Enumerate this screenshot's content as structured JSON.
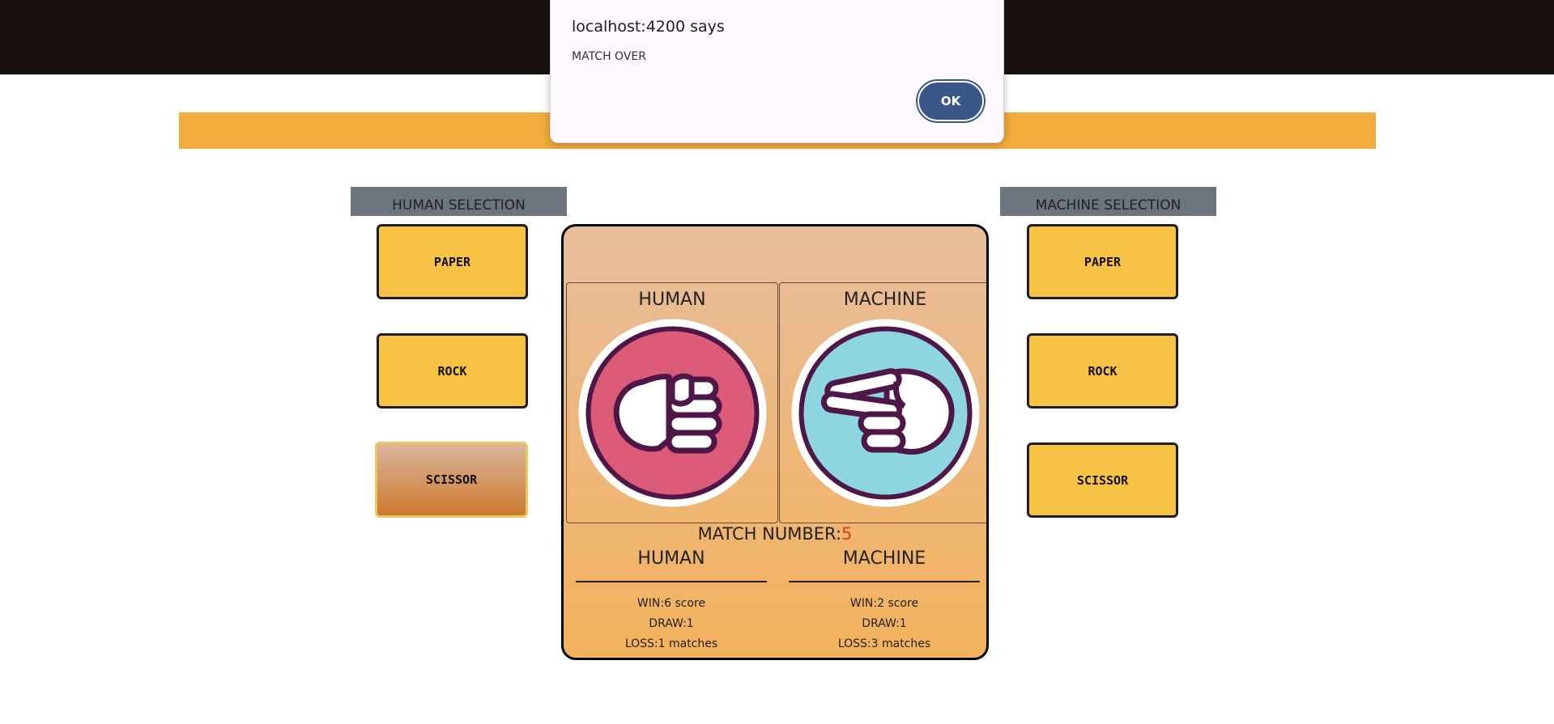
{
  "human_selection": {
    "header": "HUMAN SELECTION",
    "options": [
      "PAPER",
      "ROCK",
      "SCISSOR"
    ],
    "selected": "SCISSOR"
  },
  "machine_selection": {
    "header": "MACHINE SELECTION",
    "options": [
      "PAPER",
      "ROCK",
      "SCISSOR"
    ]
  },
  "arena": {
    "human_label": "HUMAN",
    "machine_label": "MACHINE",
    "human_hand_icon": "rock-fist-icon",
    "machine_hand_icon": "scissor-hand-icon",
    "match_number_label": "MATCH NUMBER:",
    "match_number": "5"
  },
  "scores": {
    "human": {
      "title": "HUMAN",
      "win": "WIN:6 score",
      "draw": "DRAW:1",
      "loss": "LOSS:1 matches"
    },
    "machine": {
      "title": "MACHINE",
      "win": "WIN:2 score",
      "draw": "DRAW:1",
      "loss": "LOSS:3 matches"
    }
  },
  "dialog": {
    "title": "localhost:4200 says",
    "message": "MATCH OVER",
    "ok_label": "OK"
  },
  "colors": {
    "topbar": "#1a1010",
    "orange_band": "#f2ab3c",
    "button_yellow": "#f6c344",
    "human_circle": "#db5b78",
    "machine_circle": "#8ed6df",
    "outline_purple": "#4e1747",
    "match_number": "#e53a1a",
    "ok_button": "#3b5787"
  }
}
